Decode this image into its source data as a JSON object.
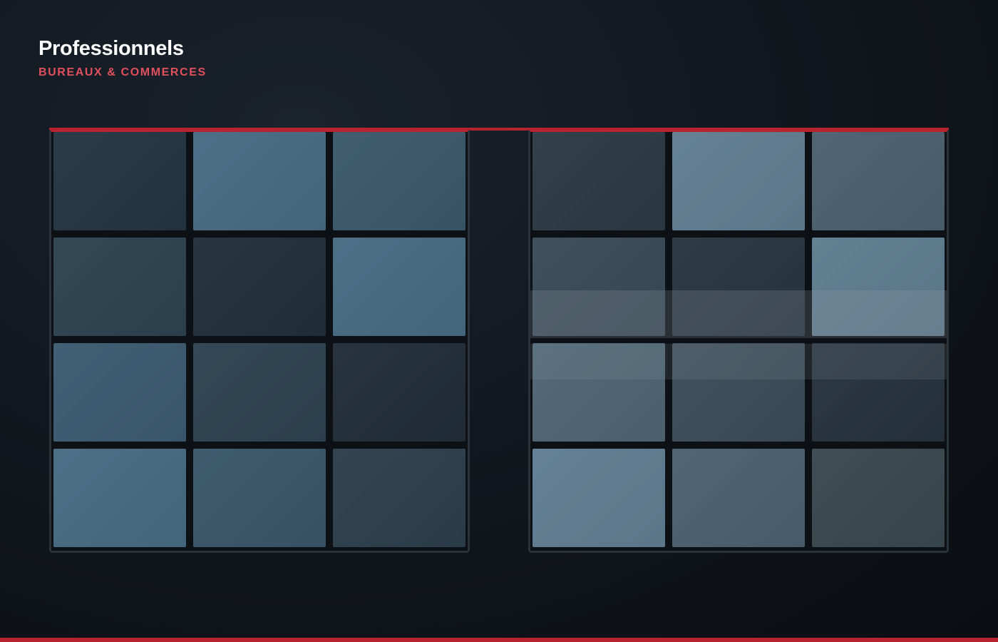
{
  "header": {
    "title": "Professionnels",
    "subtitle": "BUREAUX & COMMERCES"
  },
  "colors": {
    "accent": "#b7232f",
    "subtitle": "#e0505c",
    "background": "#11161d"
  },
  "panels": [
    {
      "name": "left",
      "tiles": [
        "#243542",
        "#476b83",
        "#3b586b",
        "#2d4250",
        "#222f3b",
        "#476b83",
        "#3d5a70",
        "#2e4251",
        "#212d38",
        "#476b83",
        "#3a566a",
        "#2d3f4d"
      ]
    },
    {
      "name": "right",
      "tiles": [
        "#2b3a45",
        "#617d92",
        "#4b6070",
        "#394b58",
        "#283540",
        "#5f7c90",
        "#4e6575",
        "#3b4d5a",
        "#26323d",
        "#617d92",
        "#4b6070",
        "#39484f"
      ]
    }
  ]
}
